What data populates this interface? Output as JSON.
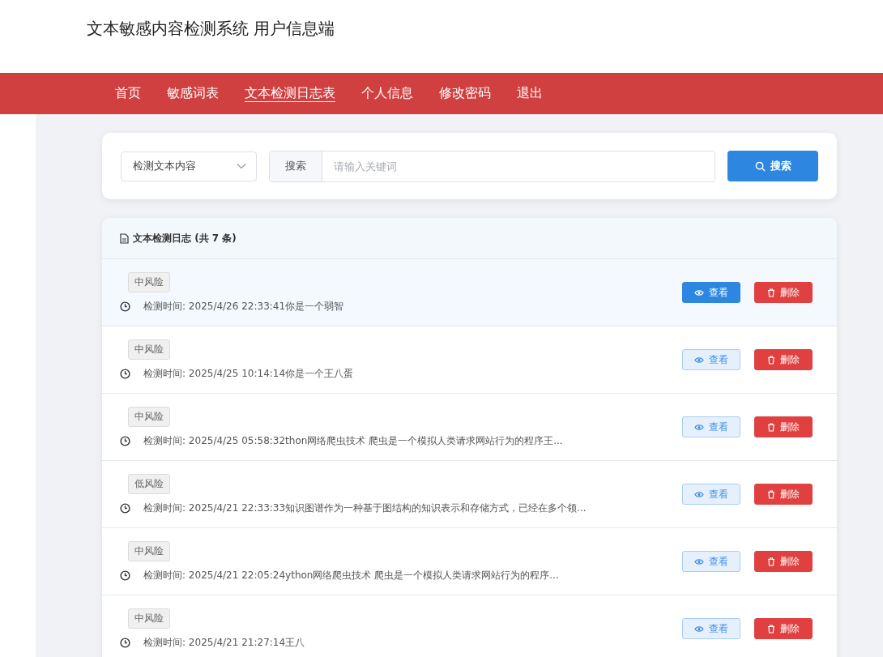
{
  "header": {
    "title": "文本敏感内容检测系统 用户信息端"
  },
  "nav": [
    {
      "label": "首页",
      "selected": false
    },
    {
      "label": "敏感词表",
      "selected": false
    },
    {
      "label": "文本检测日志表",
      "selected": true
    },
    {
      "label": "个人信息",
      "selected": false
    },
    {
      "label": "修改密码",
      "selected": false
    },
    {
      "label": "退出",
      "selected": false
    }
  ],
  "search": {
    "field_select": "检测文本内容",
    "prefix": "搜索",
    "placeholder": "请输入关键词",
    "button": "搜索"
  },
  "log": {
    "title": "文本检测日志 (共 7 条)",
    "rows": [
      {
        "risk": "中风险",
        "text": "检测时间: 2025/4/26 22:33:41你是一个弱智",
        "highlighted": true,
        "view": "查看",
        "delete": "删除"
      },
      {
        "risk": "中风险",
        "text": "检测时间: 2025/4/25 10:14:14你是一个王八蛋",
        "highlighted": false,
        "view": "查看",
        "delete": "删除"
      },
      {
        "risk": "中风险",
        "text": "检测时间: 2025/4/25 05:58:32thon网络爬虫技术 爬虫是一个模拟人类请求网站行为的程序王...",
        "highlighted": false,
        "view": "查看",
        "delete": "删除"
      },
      {
        "risk": "低风险",
        "text": "检测时间: 2025/4/21 22:33:33知识图谱作为一种基于图结构的知识表示和存储方式，已经在多个领...",
        "highlighted": false,
        "view": "查看",
        "delete": "删除"
      },
      {
        "risk": "中风险",
        "text": "检测时间: 2025/4/21 22:05:24ython网络爬虫技术 爬虫是一个模拟人类请求网站行为的程序...",
        "highlighted": false,
        "view": "查看",
        "delete": "删除"
      },
      {
        "risk": "中风险",
        "text": "检测时间: 2025/4/21 21:27:14王八",
        "highlighted": false,
        "view": "查看",
        "delete": "删除"
      }
    ]
  }
}
